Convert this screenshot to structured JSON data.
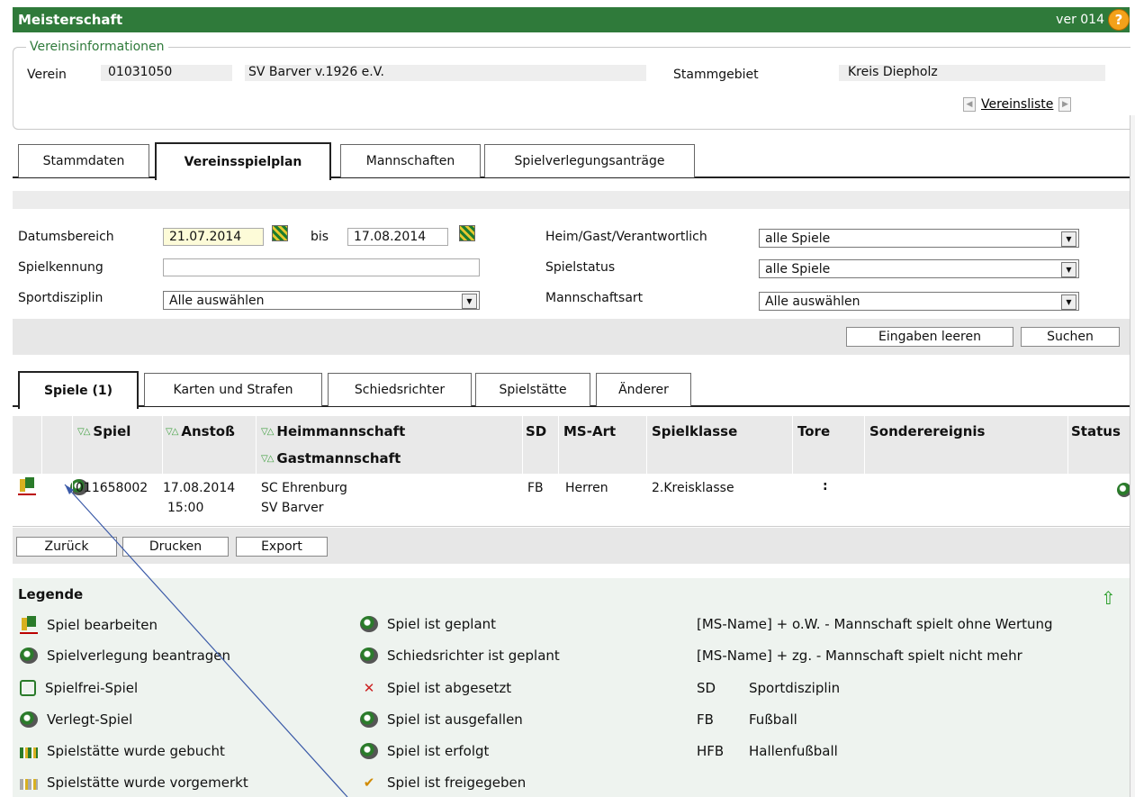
{
  "titlebar": {
    "title": "Meisterschaft",
    "version": "ver 014",
    "help": "?"
  },
  "vereinsinfo": {
    "legend": "Vereinsinformationen",
    "verein_label": "Verein",
    "verein_nr": "01031050",
    "verein_name": "SV Barver v.1926 e.V.",
    "stammgebiet_label": "Stammgebiet",
    "stammgebiet_value": "Kreis Diepholz",
    "vereinsliste_link": "Vereinsliste"
  },
  "main_tabs": [
    {
      "label": "Stammdaten"
    },
    {
      "label": "Vereinsspielplan"
    },
    {
      "label": "Mannschaften"
    },
    {
      "label": "Spielverlegungsanträge"
    }
  ],
  "filters": {
    "datumsbereich_label": "Datumsbereich",
    "date_from": "21.07.2014",
    "bis_label": "bis",
    "date_to": "17.08.2014",
    "spielkennung_label": "Spielkennung",
    "spielkennung_value": "",
    "sportdisziplin_label": "Sportdisziplin",
    "sportdisziplin_value": "Alle auswählen",
    "heimgast_label": "Heim/Gast/Verantwortlich",
    "heimgast_value": "alle Spiele",
    "spielstatus_label": "Spielstatus",
    "spielstatus_value": "alle Spiele",
    "mannschaftsart_label": "Mannschaftsart",
    "mannschaftsart_value": "Alle auswählen",
    "clear_button": "Eingaben leeren",
    "search_button": "Suchen"
  },
  "result_tabs": [
    {
      "label": "Spiele (1)"
    },
    {
      "label": "Karten und Strafen"
    },
    {
      "label": "Schiedsrichter"
    },
    {
      "label": "Spielstätte"
    },
    {
      "label": "Änderer"
    }
  ],
  "table": {
    "sort_glyph": "▽△",
    "headers": {
      "spiel": "Spiel",
      "anstoss": "Anstoß",
      "heim": "Heimmannschaft",
      "gast": "Gastmannschaft",
      "sd": "SD",
      "msart": "MS-Art",
      "spielklasse": "Spielklasse",
      "tore": "Tore",
      "sonder": "Sonderereignis",
      "status": "Status"
    },
    "rows": [
      {
        "spiel": "011658002",
        "datum": "17.08.2014",
        "zeit": "15:00",
        "heim": "SC Ehrenburg",
        "gast": "SV Barver",
        "sd": "FB",
        "msart": "Herren",
        "spielklasse": "2.Kreisklasse",
        "tore": ":",
        "sonder": ""
      }
    ]
  },
  "actions": {
    "back": "Zurück",
    "print": "Drucken",
    "export": "Export"
  },
  "legend": {
    "title": "Legende",
    "col1": [
      {
        "icon": "edit-game-icon",
        "text": "Spiel bearbeiten"
      },
      {
        "icon": "reschedule-icon",
        "text": "Spielverlegung beantragen"
      },
      {
        "icon": "free-game-icon",
        "text": "Spielfrei-Spiel"
      },
      {
        "icon": "moved-game-icon",
        "text": "Verlegt-Spiel"
      },
      {
        "icon": "venue-booked-icon",
        "text": "Spielstätte wurde gebucht"
      },
      {
        "icon": "venue-reserved-icon",
        "text": "Spielstätte wurde vorgemerkt"
      }
    ],
    "col2": [
      {
        "icon": "planned-icon",
        "text": "Spiel ist geplant"
      },
      {
        "icon": "referee-planned-icon",
        "text": "Schiedsrichter ist geplant"
      },
      {
        "icon": "cancelled-icon",
        "text": "Spiel ist abgesetzt"
      },
      {
        "icon": "failed-icon",
        "text": "Spiel ist ausgefallen"
      },
      {
        "icon": "done-icon",
        "text": "Spiel ist erfolgt"
      },
      {
        "icon": "released-icon",
        "text": "Spiel ist freigegeben"
      }
    ],
    "col3": [
      {
        "text": "[MS-Name] + o.W. - Mannschaft spielt ohne Wertung"
      },
      {
        "text": "[MS-Name] + zg. - Mannschaft spielt nicht mehr"
      },
      {
        "abbr": "SD",
        "text": "Sportdisziplin"
      },
      {
        "abbr": "FB",
        "text": "Fußball"
      },
      {
        "abbr": "HFB",
        "text": "Hallenfußball"
      }
    ]
  }
}
